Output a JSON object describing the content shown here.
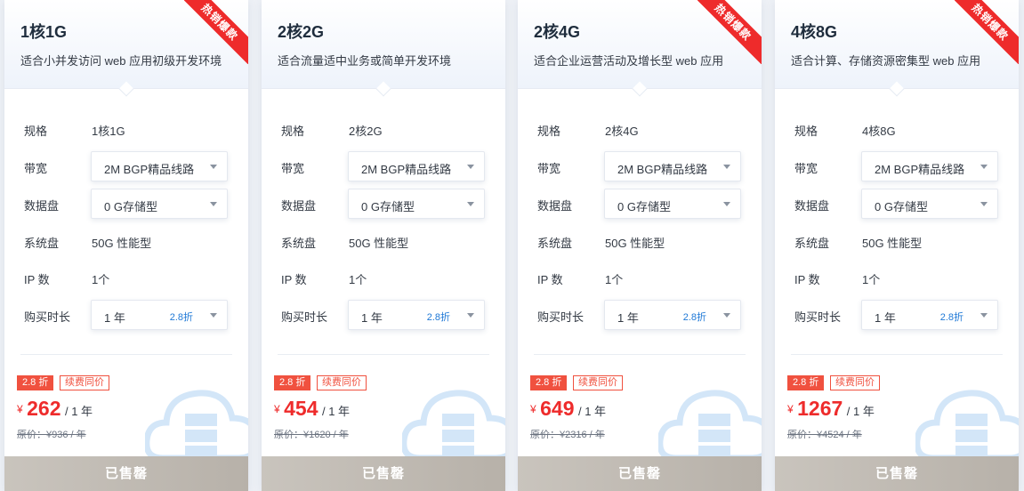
{
  "plans": [
    {
      "title": "1核1G",
      "desc": "适合小并发访问 web 应用初级开发环境",
      "ribbon": "热销爆款",
      "hot": true,
      "spec_label": "规格",
      "spec_value": "1核1G",
      "bw_label": "带宽",
      "bw_value": "2M BGP精品线路",
      "disk_label": "数据盘",
      "disk_value": "0 G存储型",
      "sysdisk_label": "系统盘",
      "sysdisk_value": "50G 性能型",
      "ip_label": "IP 数",
      "ip_value": "1个",
      "dur_label": "购买时长",
      "dur_value": "1 年",
      "dur_disc": "2.8折",
      "badge_disc": "2.8 折",
      "badge_renew": "续费同价",
      "price_symbol": "¥",
      "price": "262",
      "price_unit": "/ 1 年",
      "orig_price": "原价：¥936 / 年",
      "button": "已售罄"
    },
    {
      "title": "2核2G",
      "desc": "适合流量适中业务或简单开发环境",
      "ribbon": "",
      "hot": false,
      "spec_label": "规格",
      "spec_value": "2核2G",
      "bw_label": "带宽",
      "bw_value": "2M BGP精品线路",
      "disk_label": "数据盘",
      "disk_value": "0 G存储型",
      "sysdisk_label": "系统盘",
      "sysdisk_value": "50G 性能型",
      "ip_label": "IP 数",
      "ip_value": "1个",
      "dur_label": "购买时长",
      "dur_value": "1 年",
      "dur_disc": "2.8折",
      "badge_disc": "2.8 折",
      "badge_renew": "续费同价",
      "price_symbol": "¥",
      "price": "454",
      "price_unit": "/ 1 年",
      "orig_price": "原价：¥1620 / 年",
      "button": "已售罄"
    },
    {
      "title": "2核4G",
      "desc": "适合企业运营活动及增长型 web 应用",
      "ribbon": "热销爆款",
      "hot": true,
      "spec_label": "规格",
      "spec_value": "2核4G",
      "bw_label": "带宽",
      "bw_value": "2M BGP精品线路",
      "disk_label": "数据盘",
      "disk_value": "0 G存储型",
      "sysdisk_label": "系统盘",
      "sysdisk_value": "50G 性能型",
      "ip_label": "IP 数",
      "ip_value": "1个",
      "dur_label": "购买时长",
      "dur_value": "1 年",
      "dur_disc": "2.8折",
      "badge_disc": "2.8 折",
      "badge_renew": "续费同价",
      "price_symbol": "¥",
      "price": "649",
      "price_unit": "/ 1 年",
      "orig_price": "原价：¥2316 / 年",
      "button": "已售罄"
    },
    {
      "title": "4核8G",
      "desc": "适合计算、存储资源密集型 web 应用",
      "ribbon": "热销爆款",
      "hot": true,
      "spec_label": "规格",
      "spec_value": "4核8G",
      "bw_label": "带宽",
      "bw_value": "2M BGP精品线路",
      "disk_label": "数据盘",
      "disk_value": "0 G存储型",
      "sysdisk_label": "系统盘",
      "sysdisk_value": "50G 性能型",
      "ip_label": "IP 数",
      "ip_value": "1个",
      "dur_label": "购买时长",
      "dur_value": "1 年",
      "dur_disc": "2.8折",
      "badge_disc": "2.8 折",
      "badge_renew": "续费同价",
      "price_symbol": "¥",
      "price": "1267",
      "price_unit": "/ 1 年",
      "orig_price": "原价：¥4524 / 年",
      "button": "已售罄"
    }
  ],
  "colors": {
    "accent_red": "#ee2b2b",
    "discount_blue": "#1e78d6",
    "sold_out_gray": "#c0bab2"
  }
}
